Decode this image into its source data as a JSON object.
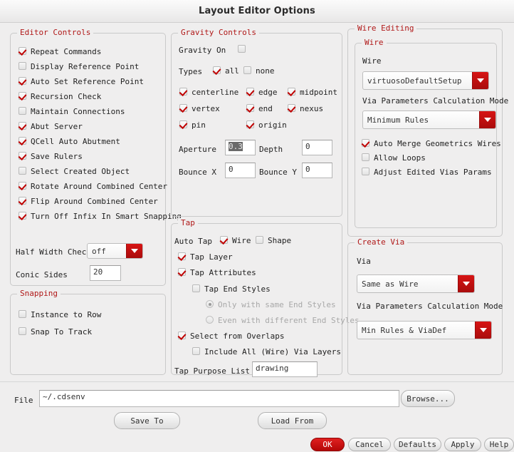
{
  "window": {
    "title": "Layout Editor Options"
  },
  "editor_controls": {
    "legend": "Editor Controls",
    "checkboxes": [
      {
        "label": "Repeat Commands",
        "checked": true
      },
      {
        "label": "Display Reference Point",
        "checked": false
      },
      {
        "label": "Auto Set Reference Point",
        "checked": true
      },
      {
        "label": "Recursion Check",
        "checked": true
      },
      {
        "label": "Maintain Connections",
        "checked": false
      },
      {
        "label": "Abut Server",
        "checked": true
      },
      {
        "label": "QCell Auto Abutment",
        "checked": true
      },
      {
        "label": "Save Rulers",
        "checked": true
      },
      {
        "label": "Select Created Object",
        "checked": false
      },
      {
        "label": "Rotate Around Combined Center",
        "checked": true
      },
      {
        "label": "Flip Around Combined Center",
        "checked": true
      },
      {
        "label": "Turn Off Infix In Smart Snapping",
        "checked": true
      }
    ],
    "half_width_check": {
      "label": "Half Width Check",
      "value": "off"
    },
    "conic_sides": {
      "label": "Conic Sides",
      "value": "20"
    }
  },
  "snapping": {
    "legend": "Snapping",
    "checkboxes": [
      {
        "label": "Instance to Row",
        "checked": false
      },
      {
        "label": "Snap To Track",
        "checked": false
      }
    ]
  },
  "gravity_controls": {
    "legend": "Gravity Controls",
    "gravity_on": {
      "label": "Gravity On",
      "checked": false
    },
    "types_label": "Types",
    "all": {
      "label": "all",
      "checked": true
    },
    "none": {
      "label": "none",
      "checked": false
    },
    "types": [
      {
        "label": "centerline",
        "checked": true
      },
      {
        "label": "edge",
        "checked": true
      },
      {
        "label": "midpoint",
        "checked": true
      },
      {
        "label": "vertex",
        "checked": true
      },
      {
        "label": "end",
        "checked": true
      },
      {
        "label": "nexus",
        "checked": true
      },
      {
        "label": "pin",
        "checked": true
      },
      {
        "label": "origin",
        "checked": true
      }
    ],
    "aperture": {
      "label": "Aperture",
      "value": "0.3",
      "selected": true
    },
    "depth": {
      "label": "Depth",
      "value": "0"
    },
    "bounce_x": {
      "label": "Bounce X",
      "value": "0"
    },
    "bounce_y": {
      "label": "Bounce Y",
      "value": "0"
    }
  },
  "tap": {
    "legend": "Tap",
    "auto_tap_label": "Auto Tap",
    "wire": {
      "label": "Wire",
      "checked": true
    },
    "shape": {
      "label": "Shape",
      "checked": false
    },
    "tap_layer": {
      "label": "Tap Layer",
      "checked": true
    },
    "tap_attributes": {
      "label": "Tap Attributes",
      "checked": true
    },
    "tap_end_styles": {
      "label": "Tap End Styles",
      "checked": false
    },
    "radio_same": {
      "label": "Only with same End Styles",
      "selected": true,
      "disabled": true
    },
    "radio_diff": {
      "label": "Even with different End Styles",
      "selected": false,
      "disabled": true
    },
    "select_from_overlaps": {
      "label": "Select from Overlaps",
      "checked": true
    },
    "include_all_via_layers": {
      "label": "Include All (Wire) Via Layers",
      "checked": false
    },
    "tap_purpose_list": {
      "label": "Tap Purpose List",
      "value": "drawing"
    }
  },
  "wire_editing": {
    "legend": "Wire Editing",
    "wire_group": {
      "legend": "Wire",
      "wire_label": "Wire",
      "wire_value": "virtuosoDefaultSetup",
      "via_params_label": "Via Parameters Calculation Mode",
      "via_params_value": "Minimum Rules",
      "checkboxes": [
        {
          "label": "Auto Merge Geometrics Wires",
          "checked": true
        },
        {
          "label": "Allow Loops",
          "checked": false
        },
        {
          "label": "Adjust Edited Vias Params",
          "checked": false
        }
      ]
    },
    "create_via": {
      "legend": "Create Via",
      "via_label": "Via",
      "via_value": "Same as Wire",
      "via_params_label": "Via Parameters Calculation Mode",
      "via_params_value": "Min Rules & ViaDef"
    }
  },
  "footer": {
    "file_label": "File",
    "file_value": "~/.cdsenv",
    "browse": "Browse...",
    "save_to": "Save To",
    "load_from": "Load From",
    "ok": "OK",
    "cancel": "Cancel",
    "defaults": "Defaults",
    "apply": "Apply",
    "help": "Help"
  },
  "colors": {
    "legend_red": "#b01818",
    "accent_red": "#c00000",
    "background": "#efeeee"
  }
}
